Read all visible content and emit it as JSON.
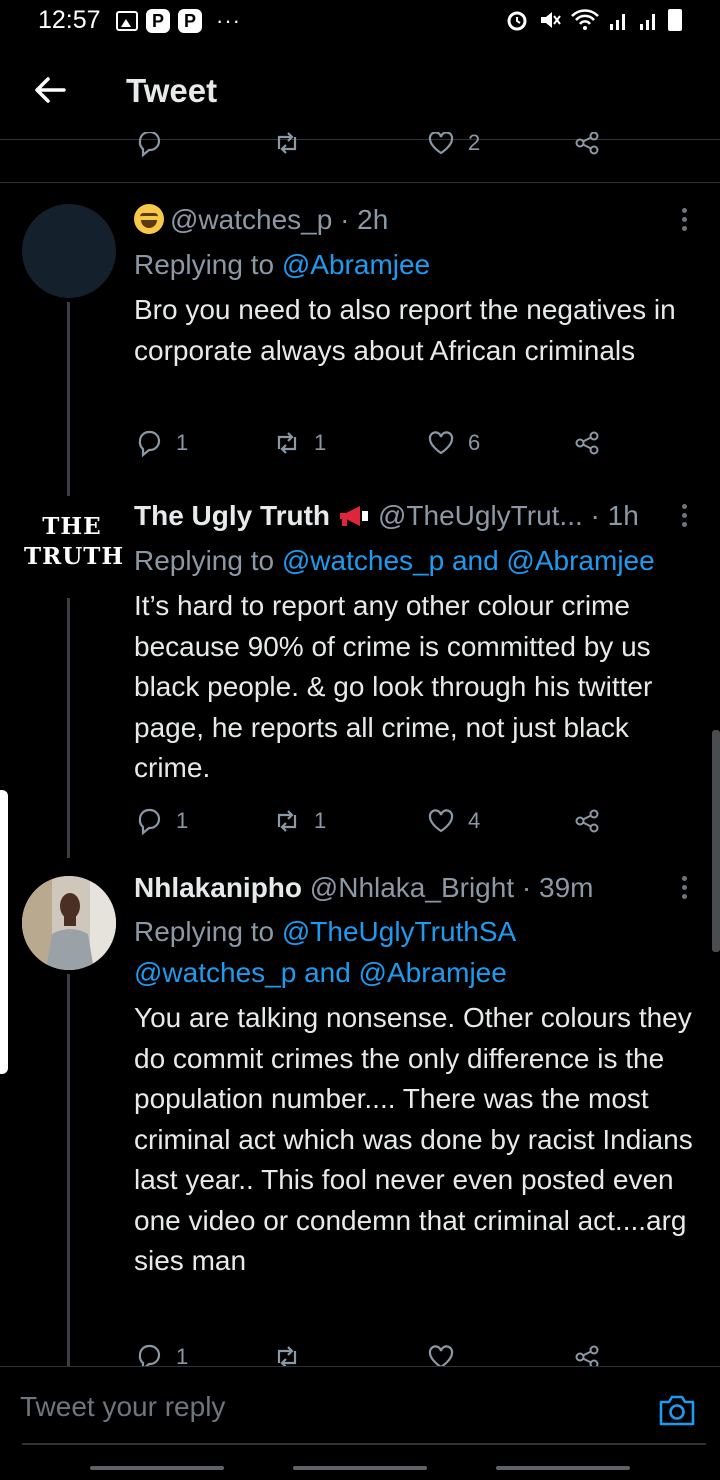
{
  "status_bar": {
    "time": "12:57",
    "more": "···"
  },
  "header": {
    "title": "Tweet"
  },
  "prev_actions": {
    "like_count": "2"
  },
  "tweets": [
    {
      "handle": "@watches_p",
      "time": "· 2h",
      "replying_prefix": "Replying to",
      "mentions": "@Abramjee",
      "text": "Bro you need to also report the negatives in corporate always about African criminals",
      "replies": "1",
      "retweets": "1",
      "likes": "6"
    },
    {
      "name": "The Ugly Truth",
      "handle": "@TheUglyTrut...",
      "time": "· 1h",
      "avatar_logo_line1": "THE",
      "avatar_logo_line2": "TRUTH",
      "replying_prefix": "Replying to",
      "mentions": "@watches_p and @Abramjee",
      "text": "It’s hard to report any other colour  crime because 90% of crime is committed by us black people. & go look through his twitter page, he reports all crime, not just black crime.",
      "replies": "1",
      "retweets": "1",
      "likes": "4"
    },
    {
      "name": "Nhlakanipho",
      "handle": "@Nhlaka_Bright",
      "time": "· 39m",
      "replying_prefix": "Replying to",
      "mentions_line1": "@TheUglyTruthSA",
      "mentions_line2": "@watches_p and @Abramjee",
      "text": "You are talking nonsense. Other colours they do commit crimes the only difference is the population number.... There was the most criminal act which was done by racist Indians last year.. This fool never even posted even one video or condemn that criminal act....arg sies man",
      "replies": "1"
    }
  ],
  "composer": {
    "placeholder": "Tweet your reply"
  },
  "colors": {
    "background": "#000000",
    "accent": "#1d9bf0",
    "muted": "#8b98a5",
    "divider": "#2f3336"
  }
}
